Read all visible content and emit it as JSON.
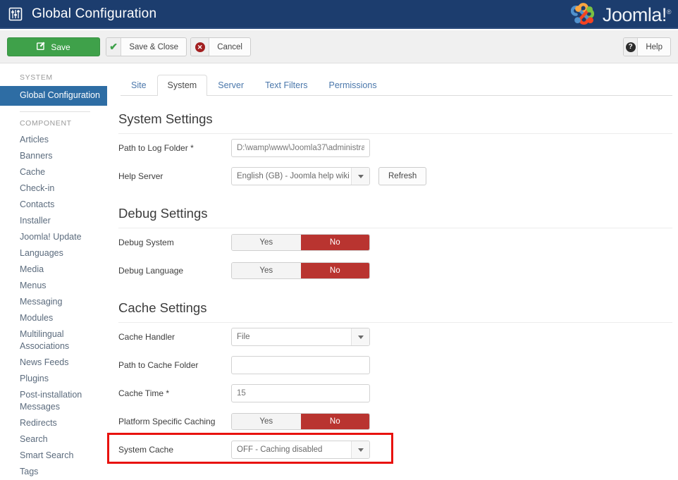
{
  "header": {
    "icon": "sliders-config-icon",
    "title": "Global Configuration",
    "brand_name": "Joomla!",
    "brand_tm": "®",
    "bg_color": "#1c3d6e"
  },
  "toolbar": {
    "save_label": "Save",
    "save_icon": "edit-square-icon",
    "save_close_label": "Save & Close",
    "save_close_icon": "checkmark-icon",
    "cancel_label": "Cancel",
    "cancel_icon": "circle-x-icon",
    "help_label": "Help",
    "help_icon": "circle-question-icon",
    "save_color": "#3fa14a"
  },
  "sidebar": {
    "groups": [
      {
        "title": "SYSTEM",
        "items": [
          {
            "label": "Global Configuration",
            "active": true
          }
        ]
      },
      {
        "title": "COMPONENT",
        "items": [
          {
            "label": "Articles",
            "active": false
          },
          {
            "label": "Banners",
            "active": false
          },
          {
            "label": "Cache",
            "active": false
          },
          {
            "label": "Check-in",
            "active": false
          },
          {
            "label": "Contacts",
            "active": false
          },
          {
            "label": "Installer",
            "active": false
          },
          {
            "label": "Joomla! Update",
            "active": false
          },
          {
            "label": "Languages",
            "active": false
          },
          {
            "label": "Media",
            "active": false
          },
          {
            "label": "Menus",
            "active": false
          },
          {
            "label": "Messaging",
            "active": false
          },
          {
            "label": "Modules",
            "active": false
          },
          {
            "label": "Multilingual Associations",
            "active": false
          },
          {
            "label": "News Feeds",
            "active": false
          },
          {
            "label": "Plugins",
            "active": false
          },
          {
            "label": "Post-installation Messages",
            "active": false
          },
          {
            "label": "Redirects",
            "active": false
          },
          {
            "label": "Search",
            "active": false
          },
          {
            "label": "Smart Search",
            "active": false
          },
          {
            "label": "Tags",
            "active": false
          }
        ]
      }
    ],
    "active_color": "#2e6da4"
  },
  "tabs": [
    {
      "label": "Site",
      "active": false
    },
    {
      "label": "System",
      "active": true
    },
    {
      "label": "Server",
      "active": false
    },
    {
      "label": "Text Filters",
      "active": false
    },
    {
      "label": "Permissions",
      "active": false
    }
  ],
  "sections": {
    "system_settings": {
      "title": "System Settings",
      "path_to_log_folder": {
        "label": "Path to Log Folder *",
        "value": "D:\\wamp\\www\\Joomla37\\administra",
        "placeholder": ""
      },
      "help_server": {
        "label": "Help Server",
        "value": "English (GB) - Joomla help wiki",
        "refresh_label": "Refresh"
      }
    },
    "debug_settings": {
      "title": "Debug Settings",
      "debug_system": {
        "label": "Debug System",
        "yes_label": "Yes",
        "no_label": "No",
        "selected": "No"
      },
      "debug_language": {
        "label": "Debug Language",
        "yes_label": "Yes",
        "no_label": "No",
        "selected": "No"
      }
    },
    "cache_settings": {
      "title": "Cache Settings",
      "cache_handler": {
        "label": "Cache Handler",
        "value": "File"
      },
      "path_to_cache_folder": {
        "label": "Path to Cache Folder",
        "value": "",
        "placeholder": ""
      },
      "cache_time": {
        "label": "Cache Time *",
        "value": "15",
        "placeholder": ""
      },
      "platform_specific_caching": {
        "label": "Platform Specific Caching",
        "yes_label": "Yes",
        "no_label": "No",
        "selected": "No"
      },
      "system_cache": {
        "label": "System Cache",
        "value": "OFF - Caching disabled",
        "highlighted": true
      }
    }
  },
  "colors": {
    "toggle_active_red": "#b93430",
    "highlight_red": "#e8120e",
    "tab_link_blue": "#4a77ab"
  }
}
